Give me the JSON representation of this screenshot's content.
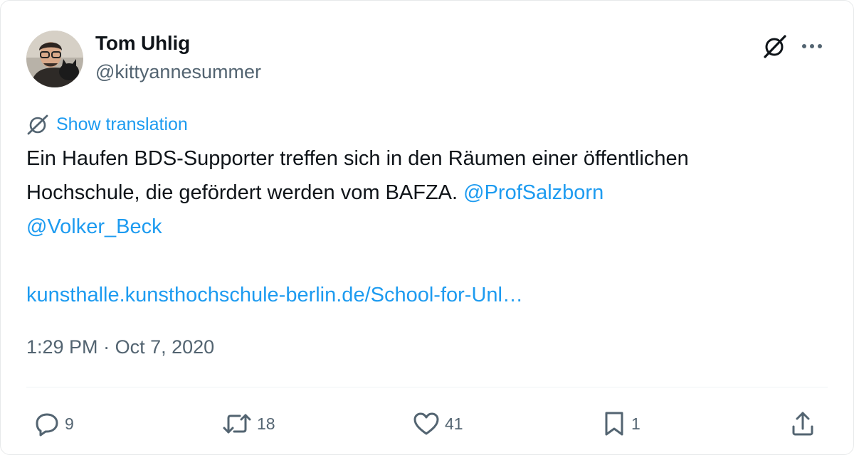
{
  "author": {
    "name": "Tom Uhlig",
    "handle": "@kittyannesummer"
  },
  "icons": {
    "grok": "grok-icon",
    "more": "more-dots-icon",
    "translate": "translate-icon",
    "reply": "reply-icon",
    "retweet": "retweet-icon",
    "like": "heart-icon",
    "bookmark": "bookmark-icon",
    "share": "share-icon"
  },
  "translation_link": "Show translation",
  "tweet": {
    "line1": "Ein Haufen BDS-Supporter treffen sich in den Räumen einer öffentlichen",
    "line2_text": "Hochschule, die gefördert werden vom BAFZA. ",
    "mention1": "@ProfSalzborn",
    "mention2": "@Volker_Beck",
    "link": "kunsthalle.kunsthochschule-berlin.de/School-for-Unl…"
  },
  "timestamp": {
    "time": "1:29 PM",
    "separator": " · ",
    "date": "Oct 7, 2020"
  },
  "actions": {
    "replies": "9",
    "retweets": "18",
    "likes": "41",
    "bookmarks": "1"
  },
  "colors": {
    "link": "#1d9bf0",
    "secondary_text": "#536471",
    "primary_text": "#0f1419",
    "border": "#e7e9ea"
  }
}
